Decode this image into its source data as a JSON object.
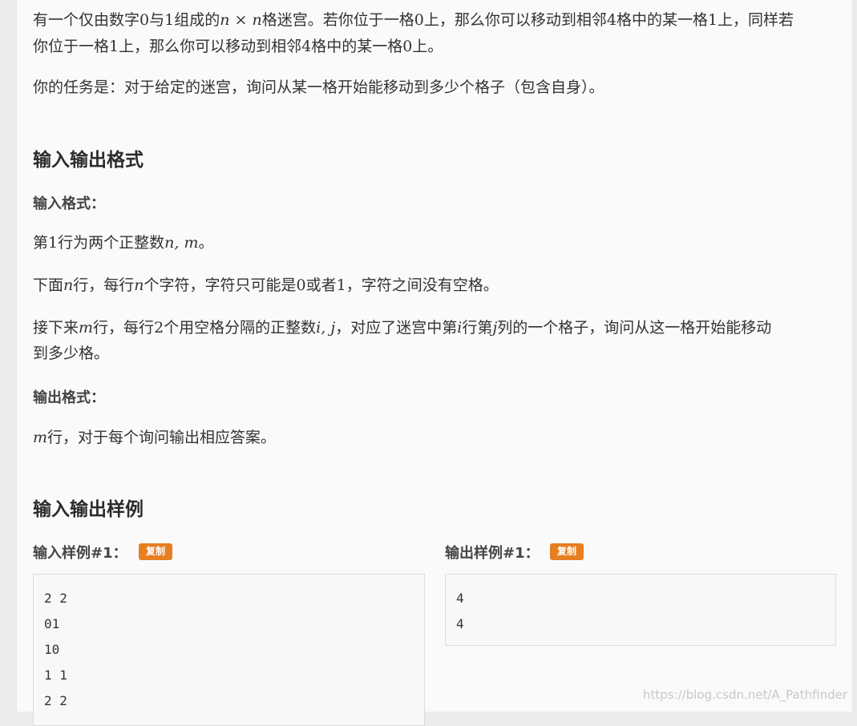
{
  "desc": {
    "l1a": "有一个仅由数字",
    "l1b": "0",
    "l1c": "与",
    "l1d": "1",
    "l1e": "组成的",
    "l1f": "n × n",
    "l1g": "格迷宫。若你位于一格",
    "l1h": "0",
    "l1i": "上，那么你可以移动到相邻",
    "l1j": "4",
    "l1k": "格中的某一格",
    "l1l": "1",
    "l1m": "上，同样若",
    "l2a": "你位于一格",
    "l2b": "1",
    "l2c": "上，那么你可以移动到相邻",
    "l2d": "4",
    "l2e": "格中的某一格",
    "l2f": "0",
    "l2g": "上。",
    "task": "你的任务是：对于给定的迷宫，询问从某一格开始能移动到多少个格子（包含自身）。"
  },
  "io_section": {
    "title": "输入输出格式",
    "input_label": "输入格式：",
    "in1a": "第",
    "in1b": "1",
    "in1c": "行为两个正整数",
    "in1d": "n, m",
    "in1e": "。",
    "in2a": "下面",
    "in2b": "n",
    "in2c": "行，每行",
    "in2d": "n",
    "in2e": "个字符，字符只可能是",
    "in2f": "0",
    "in2g": "或者",
    "in2h": "1",
    "in2i": "，字符之间没有空格。",
    "in3a": "接下来",
    "in3b": "m",
    "in3c": "行，每行",
    "in3d": "2",
    "in3e": "个用空格分隔的正整数",
    "in3f": "i, j",
    "in3g": "，对应了迷宫中第",
    "in3h": "i",
    "in3i": "行第",
    "in3j": "j",
    "in3k": "列的一个格子，询问从这一格开始能移动",
    "in3l": "到多少格。",
    "output_label": "输出格式：",
    "out1a": "m",
    "out1b": "行，对于每个询问输出相应答案。"
  },
  "samples": {
    "title": "输入输出样例",
    "input_label": "输入样例#1：",
    "output_label": "输出样例#1：",
    "copy_label": "复制",
    "input_lines": [
      "2 2",
      "01",
      "10",
      "1 1",
      "2 2"
    ],
    "output_lines": [
      "4",
      "4"
    ]
  },
  "watermark": "https://blog.csdn.net/A_Pathfinder",
  "colors": {
    "copy_button": "#e67e22"
  }
}
